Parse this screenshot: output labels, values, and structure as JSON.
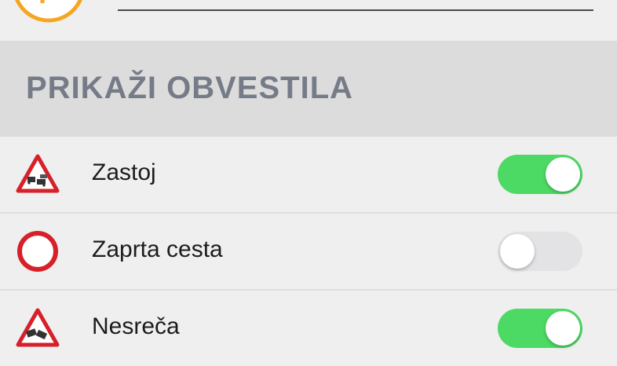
{
  "section": {
    "title": "PRIKAŽI OBVESTILA"
  },
  "rows": [
    {
      "label": "Zastoj",
      "icon": "traffic-jam-warning-icon",
      "enabled": true
    },
    {
      "label": "Zaprta cesta",
      "icon": "road-closed-icon",
      "enabled": false
    },
    {
      "label": "Nesreča",
      "icon": "accident-warning-icon",
      "enabled": true
    }
  ],
  "colors": {
    "accent_orange": "#f5a623",
    "warning_red": "#d6202a",
    "toggle_on": "#4cd964",
    "toggle_off": "#e3e3e6",
    "header_text": "#757c88"
  }
}
